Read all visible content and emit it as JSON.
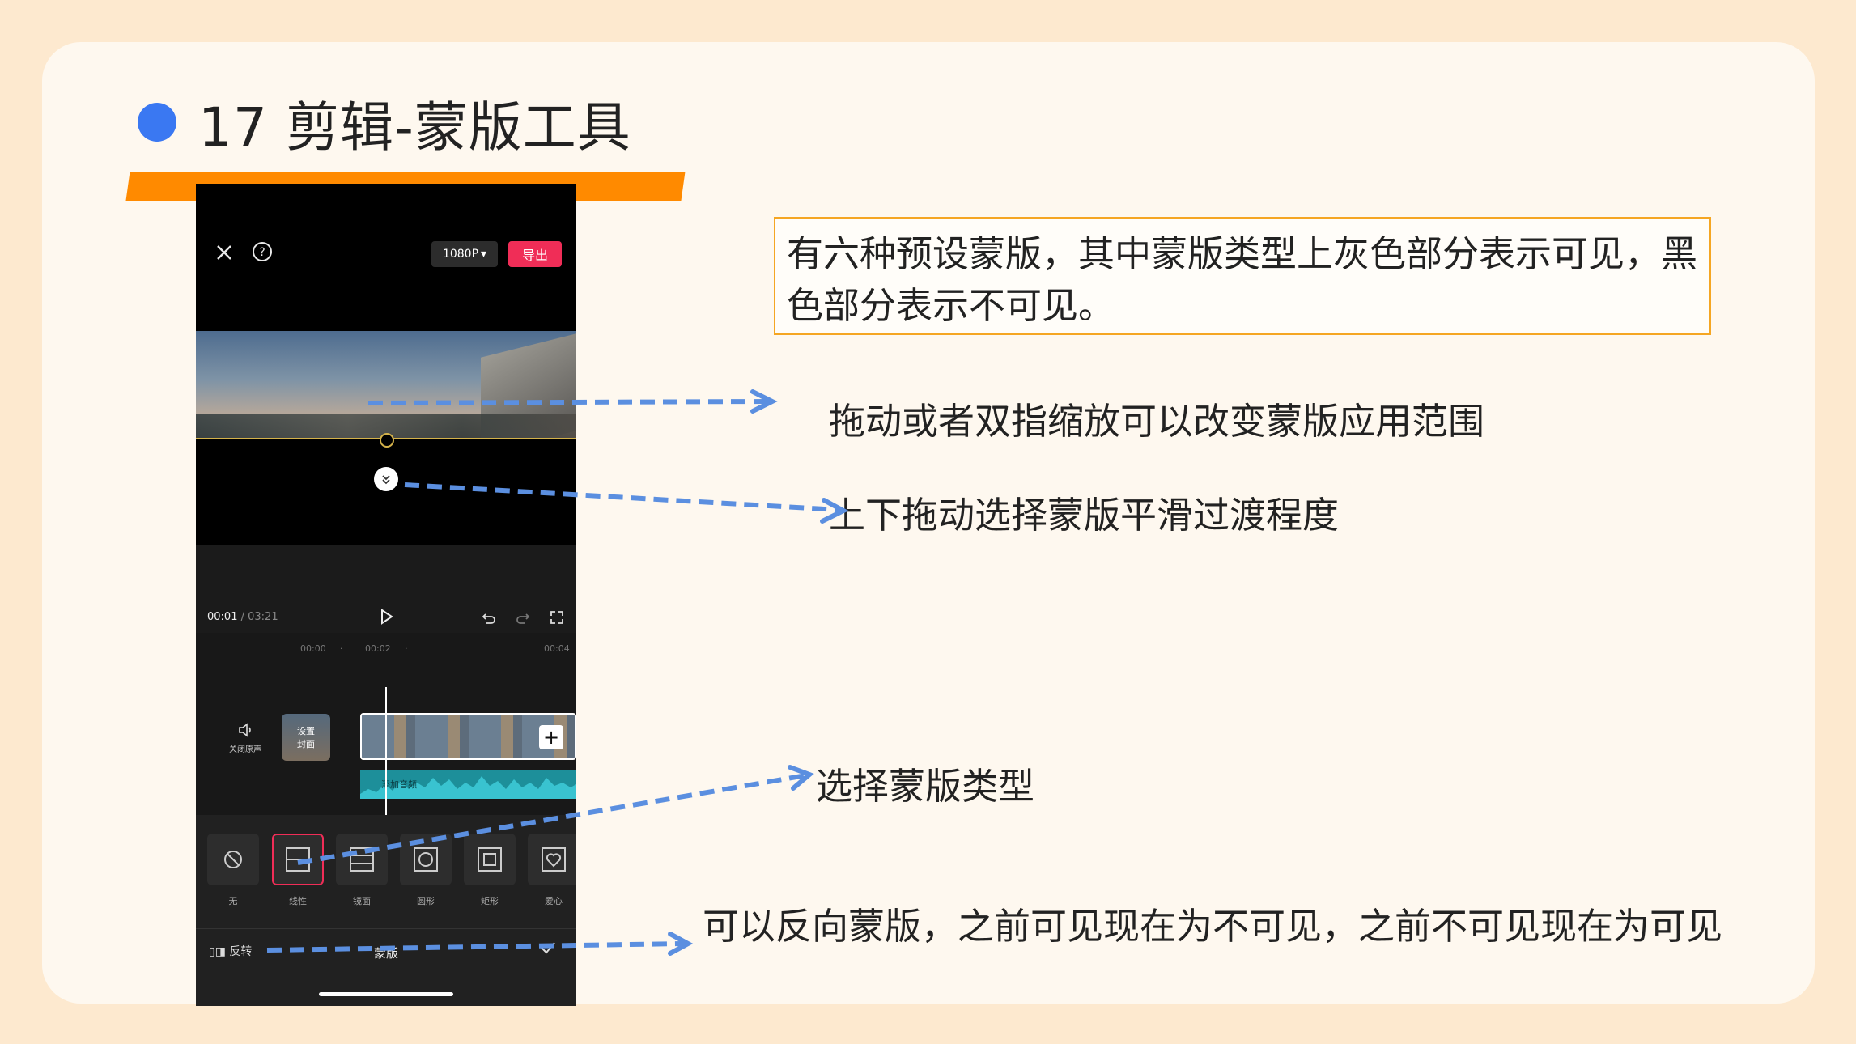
{
  "slide": {
    "title": "17 剪辑-蒙版工具",
    "accent_color": "#ff8a00",
    "dot_color": "#3a78f2"
  },
  "phone": {
    "topbar": {
      "close_icon": "close-icon",
      "help_icon": "help-icon",
      "resolution": "1080P",
      "export": "导出"
    },
    "player": {
      "time_current": "00:01",
      "time_separator": " / ",
      "time_total": "03:21"
    },
    "timeline": {
      "ruler": [
        "00:00",
        "·",
        "00:02",
        "·",
        "00:04"
      ],
      "mute_label": "关闭原声",
      "cover_label": "设置\n封面",
      "audio_label": "添加音频"
    },
    "mask_options": [
      {
        "label": "无",
        "icon": "none-icon"
      },
      {
        "label": "线性",
        "icon": "linear-mask-icon"
      },
      {
        "label": "镜面",
        "icon": "mirror-mask-icon"
      },
      {
        "label": "圆形",
        "icon": "circle-mask-icon"
      },
      {
        "label": "矩形",
        "icon": "rectangle-mask-icon"
      },
      {
        "label": "爱心",
        "icon": "heart-mask-icon"
      }
    ],
    "bottom": {
      "invert_label": "反转",
      "panel_title": "蒙版"
    }
  },
  "annotations": {
    "box_note": "有六种预设蒙版，其中蒙版类型上灰色部分表示可见，黑色部分表示不可见。",
    "drag_note": "拖动或者双指缩放可以改变蒙版应用范围",
    "feather_note": "上下拖动选择蒙版平滑过渡程度",
    "type_note": "选择蒙版类型",
    "invert_note": "可以反向蒙版，之前可见现在为不可见，之前不可见现在为可见",
    "arrow_color": "#5b8fe0"
  }
}
